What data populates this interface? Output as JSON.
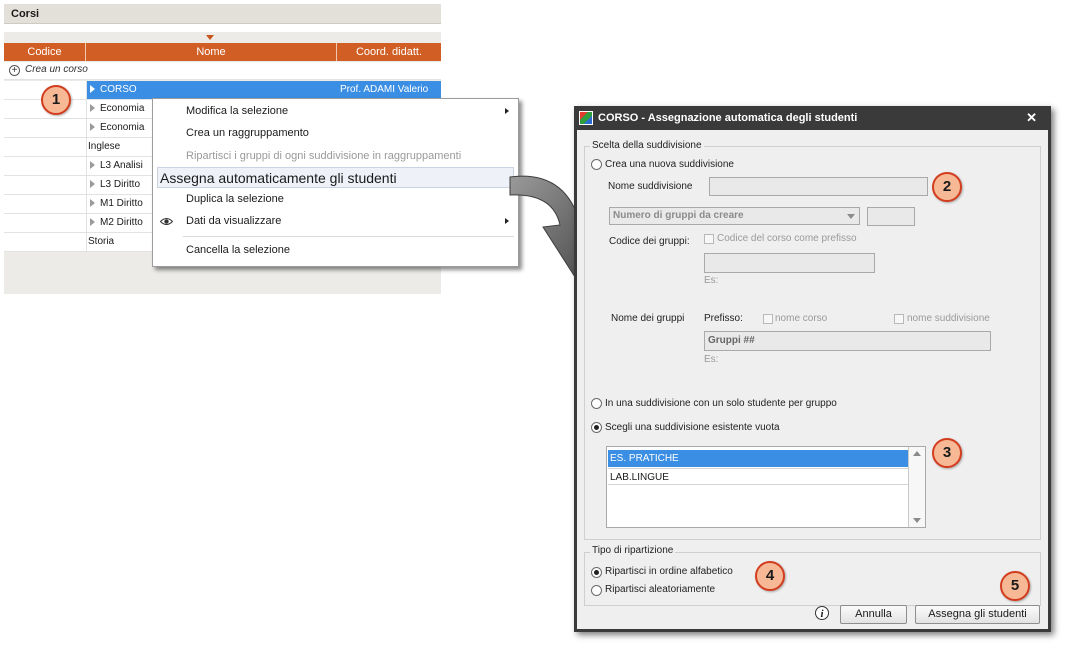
{
  "panel": {
    "title": "Corsi",
    "columns": [
      "Codice",
      "Nome",
      "Coord. didatt."
    ],
    "create_label": "Crea un corso",
    "rows": [
      {
        "name": "CORSO",
        "coord": "Prof. ADAMI Valerio",
        "expandable": true,
        "selected": true
      },
      {
        "name": "Economia",
        "coord": "",
        "expandable": true,
        "selected": false
      },
      {
        "name": "Economia",
        "coord": "",
        "expandable": true,
        "selected": false
      },
      {
        "name": "Inglese",
        "coord": "",
        "expandable": false,
        "selected": false
      },
      {
        "name": "L3 Analisi",
        "coord": "",
        "expandable": true,
        "selected": false
      },
      {
        "name": "L3 Diritto",
        "coord": "",
        "expandable": true,
        "selected": false
      },
      {
        "name": "M1 Diritto",
        "coord": "",
        "expandable": true,
        "selected": false
      },
      {
        "name": "M2 Diritto",
        "coord": "",
        "expandable": true,
        "selected": false
      },
      {
        "name": "Storia",
        "coord": "",
        "expandable": false,
        "selected": false
      }
    ]
  },
  "context_menu": {
    "items": [
      {
        "label": "Modifica la selezione",
        "submenu": true,
        "disabled": false
      },
      {
        "label": "Crea un raggruppamento",
        "submenu": false,
        "disabled": false
      },
      {
        "label": "Ripartisci i gruppi di ogni suddivisione in raggruppamenti",
        "submenu": false,
        "disabled": true
      },
      {
        "label": "Assegna automaticamente gli studenti",
        "submenu": false,
        "disabled": false,
        "highlighted": true
      },
      {
        "label": "Duplica la selezione",
        "submenu": false,
        "disabled": false
      },
      {
        "label": "Dati da visualizzare",
        "submenu": true,
        "disabled": false,
        "icon": "eye-icon"
      },
      {
        "label": "Cancella la selezione",
        "submenu": false,
        "disabled": false
      }
    ]
  },
  "dialog": {
    "title": "CORSO - Assegnazione automatica degli studenti",
    "close_glyph": "✕",
    "section1": {
      "title": "Scelta della suddivisione",
      "radio_new": "Crea una nuova suddivisione",
      "name_label": "Nome suddivisione",
      "name_value": "",
      "groups_count_placeholder": "Numero di gruppi da creare",
      "groups_count_value": "",
      "code_label": "Codice dei gruppi:",
      "code_prefix_checkbox": "Codice del corso come prefisso",
      "code_value": "",
      "example_label": "Es:",
      "group_name_label": "Nome dei gruppi",
      "prefix_label": "Prefisso:",
      "prefix_course": "nome corso",
      "prefix_subdivision": "nome suddivisione",
      "group_name_value": "Gruppi ##",
      "example_label2": "Es:",
      "radio_single": "In una suddivisione con un solo studente per gruppo",
      "radio_existing": "Scegli una suddivisione esistente vuota",
      "existing_list": [
        "ES. PRATICHE",
        "LAB.LINGUE"
      ],
      "selected_index": 0
    },
    "section2": {
      "title": "Tipo di ripartizione",
      "radio_alpha": "Ripartisci in ordine alfabetico",
      "radio_random": "Ripartisci aleatoriamente"
    },
    "buttons": {
      "info": "i",
      "cancel": "Annulla",
      "assign": "Assegna gli studenti"
    }
  },
  "badges": [
    "1",
    "2",
    "3",
    "4",
    "5"
  ],
  "colors": {
    "header": "#d15f25",
    "selection": "#3a8ee3",
    "badge_fill": "#f7b995",
    "badge_border": "#d33d1f",
    "dialog_titlebar": "#3a3a3a"
  }
}
